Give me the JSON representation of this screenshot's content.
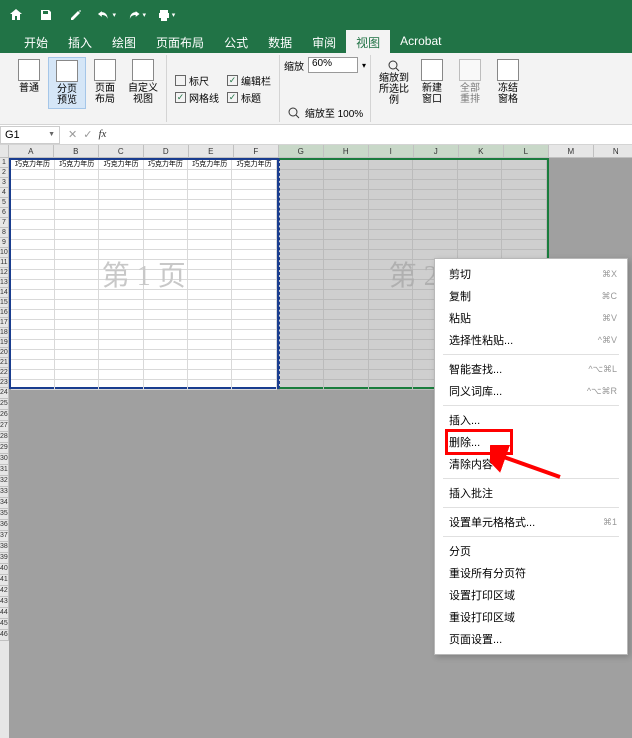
{
  "titlebar": {
    "icons": [
      "home",
      "save",
      "edit",
      "undo",
      "redo",
      "print"
    ]
  },
  "tabs": {
    "items": [
      "开始",
      "插入",
      "绘图",
      "页面布局",
      "公式",
      "数据",
      "审阅",
      "视图",
      "Acrobat"
    ],
    "active": 7
  },
  "ribbon": {
    "view_modes": {
      "normal": "普通",
      "page_break": "分页\n预览",
      "page_layout": "页面\n布局",
      "custom": "自定义\n视图"
    },
    "checks": {
      "ruler": "标尺",
      "gridlines": "网格线",
      "formula_bar": "编辑栏",
      "headings": "标题"
    },
    "zoom": {
      "label": "缩放",
      "value": "60%",
      "to100": "缩放至 100%",
      "to_selection": "缩放到\n所选比例",
      "new_window": "新建\n窗口",
      "arrange": "全部\n重排",
      "freeze": "冻结\n窗格"
    }
  },
  "namebox": {
    "ref": "G1"
  },
  "columns": [
    "A",
    "B",
    "C",
    "D",
    "E",
    "F",
    "G",
    "H",
    "I",
    "J",
    "K",
    "L",
    "M",
    "N"
  ],
  "cell_header_text": "巧克力年历",
  "page1_label": "第 1 页",
  "page2_label": "第 2",
  "row_count": 46,
  "context_menu": {
    "items": [
      {
        "label": "剪切",
        "shortcut": "⌘X"
      },
      {
        "label": "复制",
        "shortcut": "⌘C"
      },
      {
        "label": "粘贴",
        "shortcut": "⌘V"
      },
      {
        "label": "选择性粘贴...",
        "shortcut": "^⌘V"
      },
      {
        "sep": true
      },
      {
        "label": "智能查找...",
        "shortcut": "^⌥⌘L"
      },
      {
        "label": "同义词库...",
        "shortcut": "^⌥⌘R"
      },
      {
        "sep": true
      },
      {
        "label": "插入..."
      },
      {
        "label": "删除...",
        "highlight": true
      },
      {
        "label": "清除内容"
      },
      {
        "sep": true
      },
      {
        "label": "插入批注"
      },
      {
        "sep": true
      },
      {
        "label": "设置单元格格式...",
        "shortcut": "⌘1"
      },
      {
        "sep": true
      },
      {
        "label": "分页"
      },
      {
        "label": "重设所有分页符"
      },
      {
        "label": "设置打印区域"
      },
      {
        "label": "重设打印区域"
      },
      {
        "label": "页面设置..."
      }
    ]
  }
}
